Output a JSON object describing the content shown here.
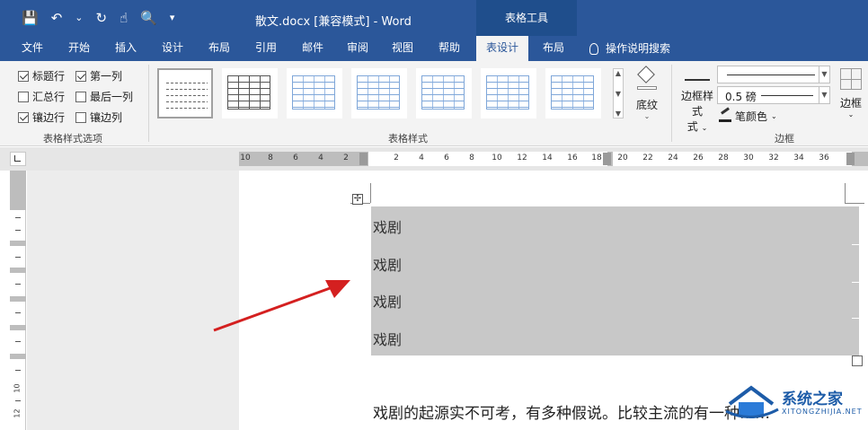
{
  "window": {
    "doc_title": "散文.docx [兼容模式] - Word",
    "context_tab_group": "表格工具"
  },
  "qat": {
    "save_icon": "save-icon",
    "undo_icon": "undo-icon",
    "redo_icon": "redo-icon",
    "touch_icon": "touch-mode-icon",
    "preview_icon": "print-preview-icon",
    "customize_icon": "customize-qat-icon"
  },
  "tabs": [
    {
      "label": "文件"
    },
    {
      "label": "开始"
    },
    {
      "label": "插入"
    },
    {
      "label": "设计"
    },
    {
      "label": "布局"
    },
    {
      "label": "引用"
    },
    {
      "label": "邮件"
    },
    {
      "label": "审阅"
    },
    {
      "label": "视图"
    },
    {
      "label": "帮助"
    },
    {
      "label": "表设计",
      "active": true
    },
    {
      "label": "布局"
    }
  ],
  "tell_me": "操作说明搜索",
  "ribbon": {
    "style_options": {
      "label": "表格样式选项",
      "items": [
        {
          "label": "标题行",
          "checked": true
        },
        {
          "label": "第一列",
          "checked": true
        },
        {
          "label": "汇总行",
          "checked": false
        },
        {
          "label": "最后一列",
          "checked": false
        },
        {
          "label": "镶边行",
          "checked": true
        },
        {
          "label": "镶边列",
          "checked": false
        }
      ]
    },
    "table_styles": {
      "label": "表格样式"
    },
    "shading": {
      "label": "底纹"
    },
    "borders": {
      "label": "边框",
      "border_styles_label": "边框样式",
      "border_styles_label_line2": "式",
      "weight": "0.5 磅",
      "pen_color": "笔颜色",
      "borders_button": "边框"
    }
  },
  "ruler": {
    "ticks": [
      "10",
      "8",
      "6",
      "4",
      "2",
      "2",
      "4",
      "6",
      "8",
      "10",
      "12",
      "14",
      "16",
      "18",
      "20",
      "22",
      "24",
      "26",
      "28",
      "30",
      "32",
      "34",
      "36"
    ],
    "vertical_ticks": [
      "10",
      "12"
    ]
  },
  "document": {
    "table_rows": [
      "戏剧",
      "戏剧",
      "戏剧",
      "戏剧"
    ],
    "paragraph": "戏剧的起源实不可考，有多种假说。比较主流的有一种……"
  },
  "watermark": {
    "title": "系统之家",
    "subtitle": "XITONGZHIJIA.NET"
  }
}
